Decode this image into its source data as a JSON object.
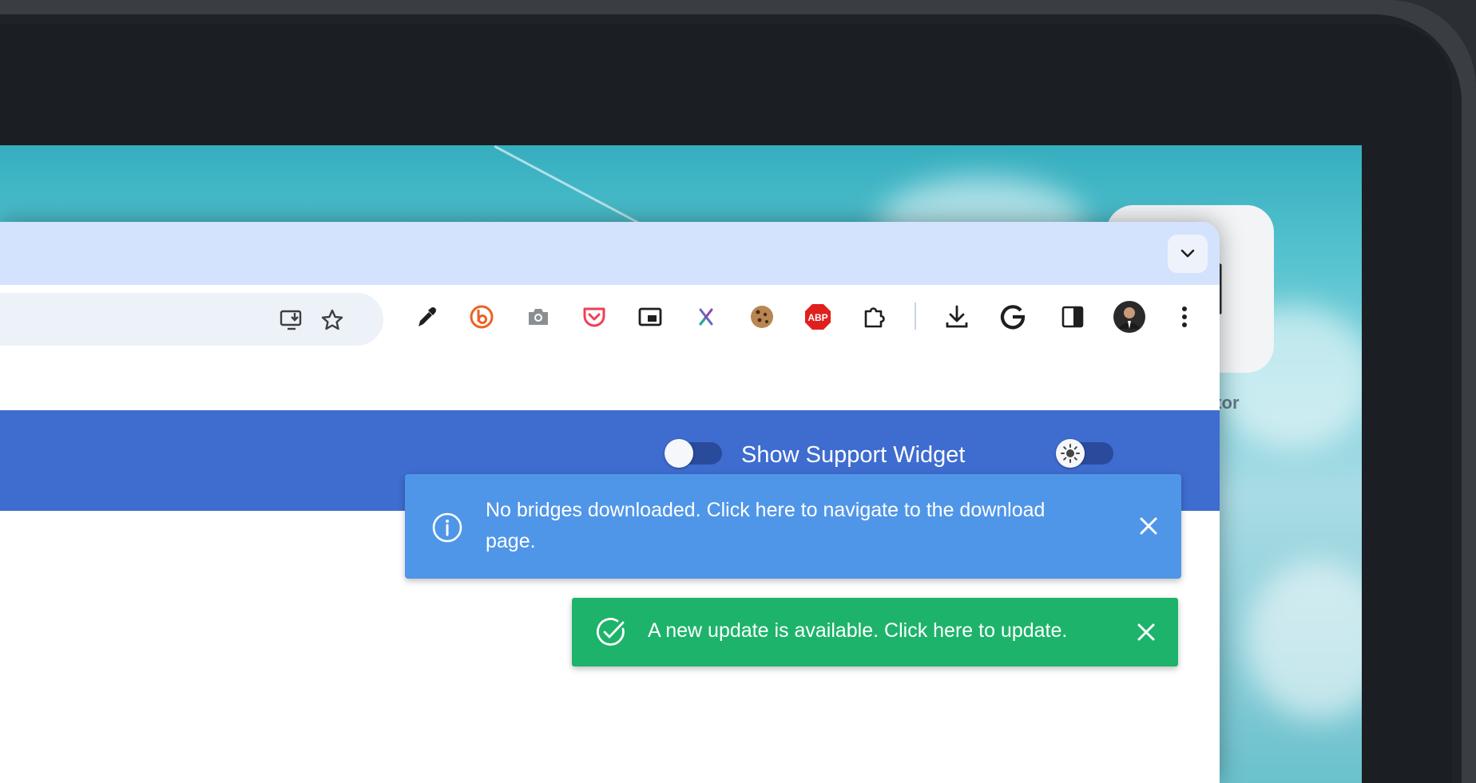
{
  "support_widget": {
    "label": "Show Support Widget",
    "enabled": false
  },
  "theme_toggle": {
    "icon": "sun-icon",
    "enabled": false
  },
  "notifications": {
    "info": {
      "icon": "info-circle-icon",
      "message": "No bridges downloaded. Click here to navigate to the download page.",
      "color": "#5096e8"
    },
    "update": {
      "icon": "check-circle-icon",
      "message": "A new update is available. Click here to update.",
      "color": "#1db36b"
    }
  },
  "toolbar": {
    "omnibox_icons": [
      "install-app-icon",
      "bookmark-star-icon"
    ],
    "extensions": [
      "color-picker-icon",
      "bitly-icon",
      "screenshot-camera-icon",
      "pocket-icon",
      "picture-in-picture-icon",
      "x-extension-icon",
      "cookie-icon",
      "adblock-plus-icon",
      "extensions-puzzle-icon"
    ],
    "right_icons": [
      "download-icon",
      "google-icon",
      "side-panel-icon",
      "profile-avatar",
      "more-menu-icon"
    ],
    "adblock_label": "ABP"
  },
  "desktop": {
    "icon_label": "ctor"
  },
  "header_color": "#3e6ccf"
}
